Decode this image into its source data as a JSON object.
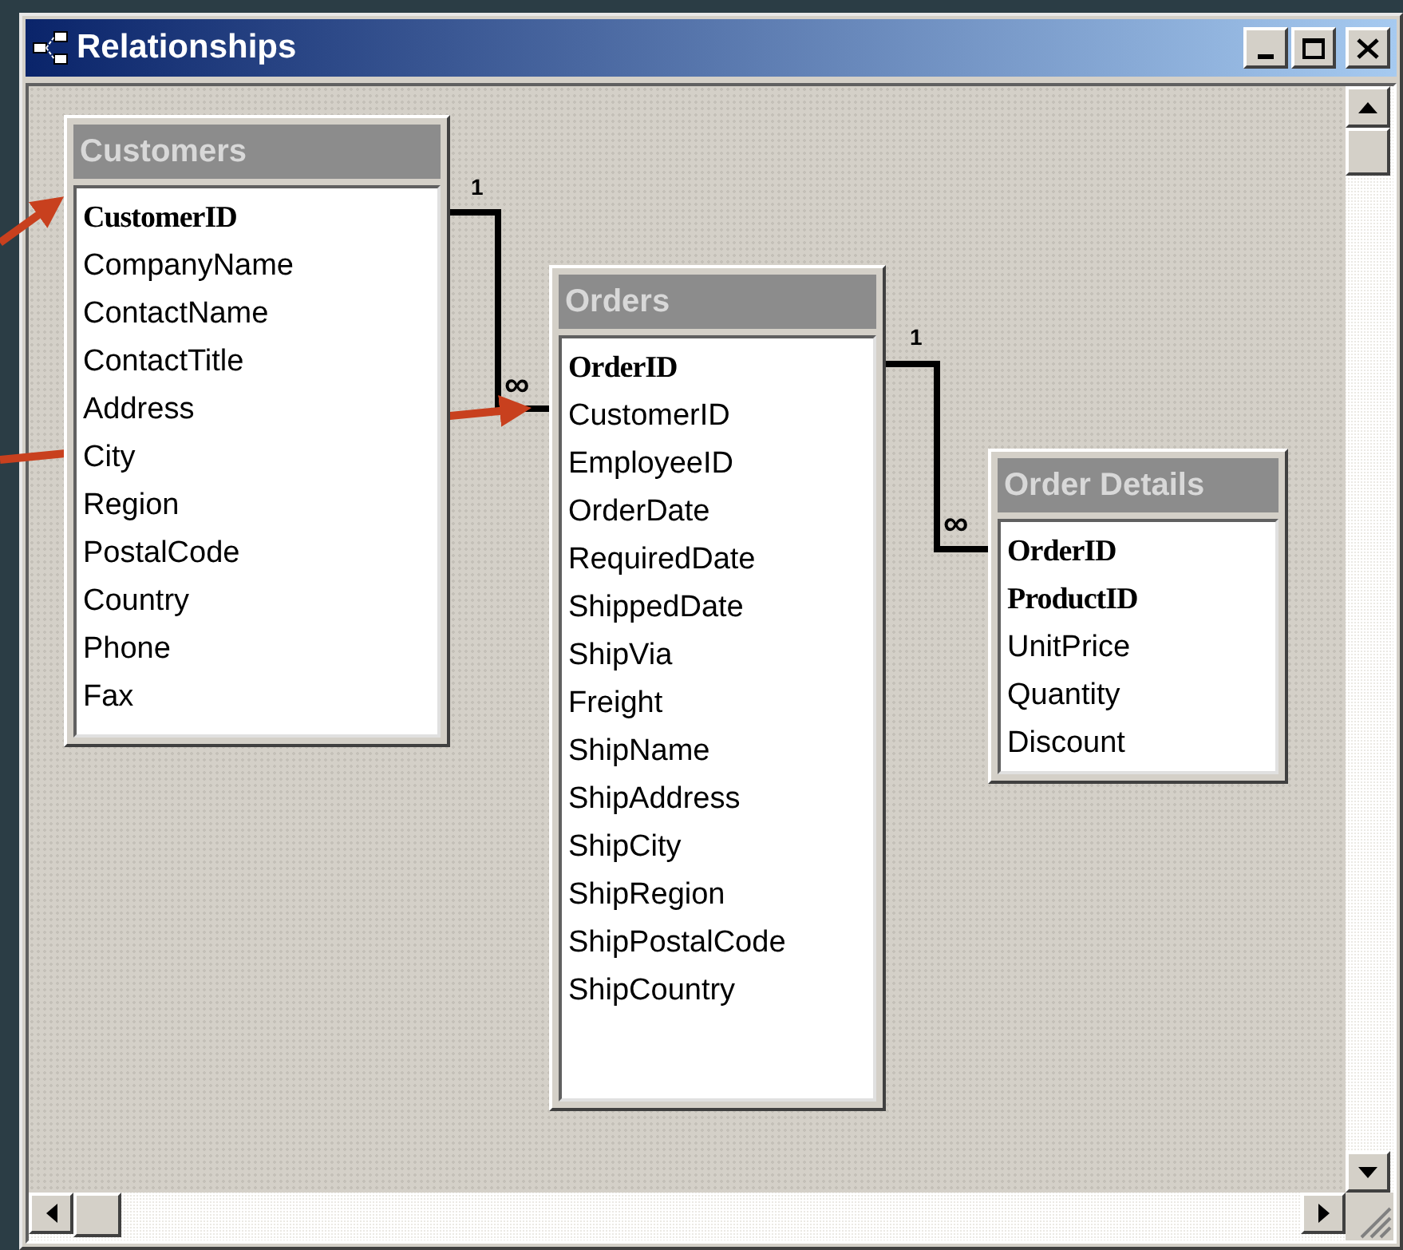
{
  "window": {
    "title": "Relationships"
  },
  "tables": [
    {
      "name": "Customers",
      "fields": [
        {
          "name": "CustomerID",
          "primary_key": true
        },
        {
          "name": "CompanyName",
          "primary_key": false
        },
        {
          "name": "ContactName",
          "primary_key": false
        },
        {
          "name": "ContactTitle",
          "primary_key": false
        },
        {
          "name": "Address",
          "primary_key": false
        },
        {
          "name": "City",
          "primary_key": false
        },
        {
          "name": "Region",
          "primary_key": false
        },
        {
          "name": "PostalCode",
          "primary_key": false
        },
        {
          "name": "Country",
          "primary_key": false
        },
        {
          "name": "Phone",
          "primary_key": false
        },
        {
          "name": "Fax",
          "primary_key": false
        }
      ]
    },
    {
      "name": "Orders",
      "fields": [
        {
          "name": "OrderID",
          "primary_key": true
        },
        {
          "name": "CustomerID",
          "primary_key": false
        },
        {
          "name": "EmployeeID",
          "primary_key": false
        },
        {
          "name": "OrderDate",
          "primary_key": false
        },
        {
          "name": "RequiredDate",
          "primary_key": false
        },
        {
          "name": "ShippedDate",
          "primary_key": false
        },
        {
          "name": "ShipVia",
          "primary_key": false
        },
        {
          "name": "Freight",
          "primary_key": false
        },
        {
          "name": "ShipName",
          "primary_key": false
        },
        {
          "name": "ShipAddress",
          "primary_key": false
        },
        {
          "name": "ShipCity",
          "primary_key": false
        },
        {
          "name": "ShipRegion",
          "primary_key": false
        },
        {
          "name": "ShipPostalCode",
          "primary_key": false
        },
        {
          "name": "ShipCountry",
          "primary_key": false
        }
      ]
    },
    {
      "name": "Order Details",
      "fields": [
        {
          "name": "OrderID",
          "primary_key": true
        },
        {
          "name": "ProductID",
          "primary_key": true
        },
        {
          "name": "UnitPrice",
          "primary_key": false
        },
        {
          "name": "Quantity",
          "primary_key": false
        },
        {
          "name": "Discount",
          "primary_key": false
        }
      ]
    }
  ],
  "relationships": [
    {
      "one": "1",
      "many": "∞"
    },
    {
      "one": "1",
      "many": "∞"
    }
  ]
}
